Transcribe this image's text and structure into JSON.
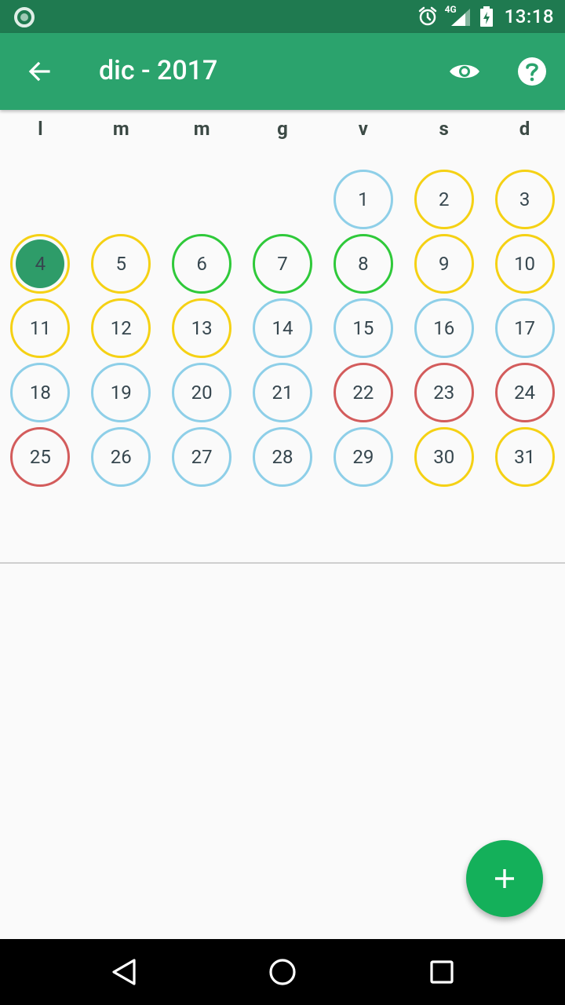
{
  "status_bar": {
    "time": "13:18",
    "network": "4G"
  },
  "app_bar": {
    "title": "dic - 2017",
    "back_icon": "arrow-back-icon",
    "eye_icon": "eye-icon",
    "help_icon": "help-icon"
  },
  "calendar": {
    "weekdays": [
      "l",
      "m",
      "m",
      "g",
      "v",
      "s",
      "d"
    ],
    "colors": {
      "blue": "#8ecfe8",
      "yellow": "#f5d114",
      "green": "#2fc93a",
      "red": "#d35c5c",
      "selected_fill": "#2e9c69"
    },
    "days": [
      {
        "label": "1",
        "status": "blue"
      },
      {
        "label": "2",
        "status": "yellow"
      },
      {
        "label": "3",
        "status": "yellow"
      },
      {
        "label": "4",
        "status": "yellow",
        "selected": true
      },
      {
        "label": "5",
        "status": "yellow"
      },
      {
        "label": "6",
        "status": "green"
      },
      {
        "label": "7",
        "status": "green"
      },
      {
        "label": "8",
        "status": "green"
      },
      {
        "label": "9",
        "status": "yellow"
      },
      {
        "label": "10",
        "status": "yellow"
      },
      {
        "label": "11",
        "status": "yellow"
      },
      {
        "label": "12",
        "status": "yellow"
      },
      {
        "label": "13",
        "status": "yellow"
      },
      {
        "label": "14",
        "status": "blue"
      },
      {
        "label": "15",
        "status": "blue"
      },
      {
        "label": "16",
        "status": "blue"
      },
      {
        "label": "17",
        "status": "blue"
      },
      {
        "label": "18",
        "status": "blue"
      },
      {
        "label": "19",
        "status": "blue"
      },
      {
        "label": "20",
        "status": "blue"
      },
      {
        "label": "21",
        "status": "blue"
      },
      {
        "label": "22",
        "status": "red"
      },
      {
        "label": "23",
        "status": "red"
      },
      {
        "label": "24",
        "status": "red"
      },
      {
        "label": "25",
        "status": "red"
      },
      {
        "label": "26",
        "status": "blue"
      },
      {
        "label": "27",
        "status": "blue"
      },
      {
        "label": "28",
        "status": "blue"
      },
      {
        "label": "29",
        "status": "blue"
      },
      {
        "label": "30",
        "status": "yellow"
      },
      {
        "label": "31",
        "status": "yellow"
      }
    ]
  },
  "fab": {
    "icon": "plus-icon"
  },
  "nav_bar": {
    "back_icon": "nav-back-icon",
    "home_icon": "nav-home-icon",
    "recents_icon": "nav-recents-icon"
  }
}
